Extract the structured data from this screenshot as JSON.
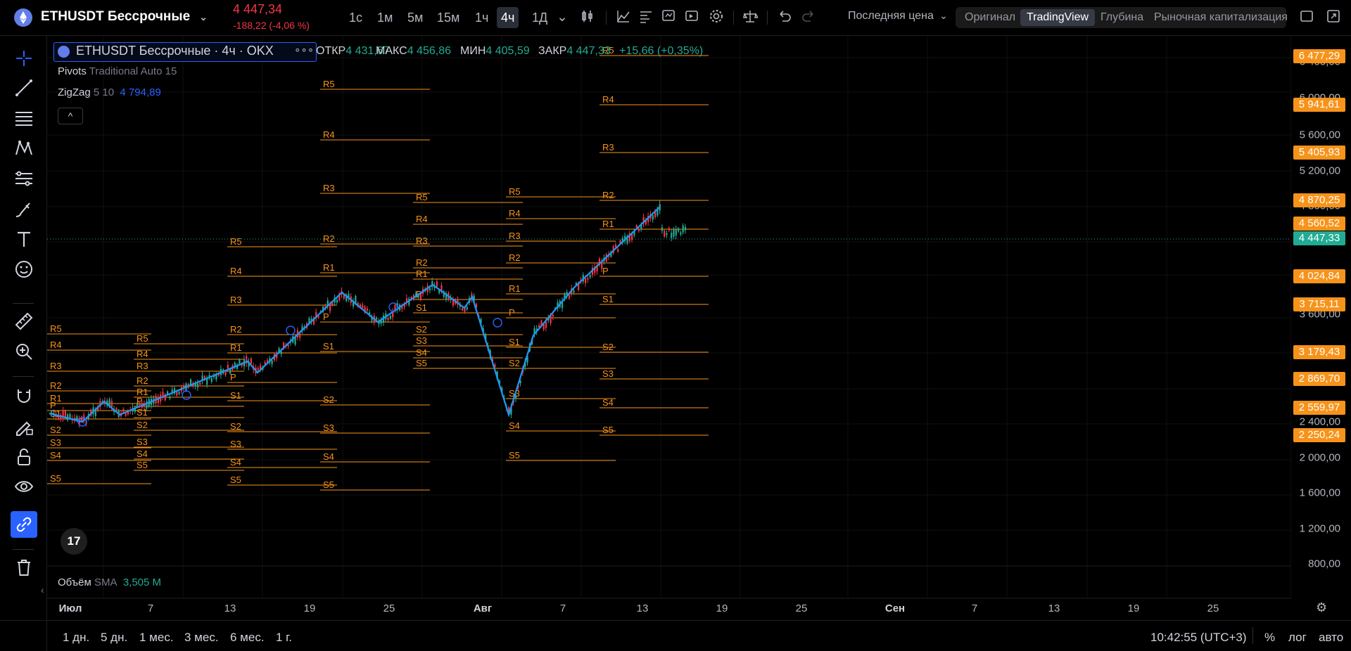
{
  "header": {
    "symbol": "ETHUSDT Бессрочные",
    "price": "4 447,34",
    "change": "-188,22 (-4,06 %)",
    "timeframes": [
      "1с",
      "1м",
      "5м",
      "15м",
      "1ч",
      "4ч",
      "1Д"
    ],
    "active_timeframe": "4ч",
    "price_type": "Последняя цена",
    "views": [
      "Оригинал",
      "TradingView",
      "Глубина",
      "Рыночная капитализация"
    ],
    "active_view": "TradingView"
  },
  "legend": {
    "title": "ETHUSDT Бессрочные · 4ч · OKX",
    "more": "∘∘∘",
    "ohlc": [
      {
        "key": "ОТКР",
        "value": "4 431,67"
      },
      {
        "key": "МАКС",
        "value": "4 456,86"
      },
      {
        "key": "МИН",
        "value": "4 405,59"
      },
      {
        "key": "ЗАКР",
        "value": "4 447,33"
      }
    ],
    "change": "+15,66 (+0,35%)",
    "indicators": [
      {
        "name": "Pivots",
        "params": "Traditional Auto 15",
        "value": ""
      },
      {
        "name": "ZigZag",
        "params": "5 10",
        "value": "4 794,89"
      }
    ],
    "collapse": "^"
  },
  "price_axis": {
    "ticks": [
      "6 400,00",
      "6 000,00",
      "5 600,00",
      "5 200,00",
      "4 800,00",
      "3 600,00",
      "2 400,00",
      "2 000,00",
      "1 600,00",
      "1 200,00",
      "800,00"
    ],
    "labels": [
      {
        "text": "6 477,29",
        "color": "#f7931a"
      },
      {
        "text": "5 941,61",
        "color": "#f7931a"
      },
      {
        "text": "5 405,93",
        "color": "#f7931a"
      },
      {
        "text": "4 870,25",
        "color": "#f7931a"
      },
      {
        "text": "4 560,52",
        "color": "#f7931a"
      },
      {
        "text": "4 447,33",
        "color": "#22ab94"
      },
      {
        "text": "4 024,84",
        "color": "#f7931a"
      },
      {
        "text": "3 715,11",
        "color": "#f7931a"
      },
      {
        "text": "3 179,43",
        "color": "#f7931a"
      },
      {
        "text": "2 869,70",
        "color": "#f7931a"
      },
      {
        "text": "2 559,97",
        "color": "#f7931a"
      },
      {
        "text": "2 250,24",
        "color": "#f7931a"
      }
    ]
  },
  "volume": {
    "name": "Объём",
    "ma": "SMA",
    "value": "3,505 M"
  },
  "time_axis": {
    "ticks": [
      "Июл",
      "7",
      "13",
      "19",
      "25",
      "Авг",
      "7",
      "13",
      "19",
      "25",
      "Сен",
      "7",
      "13",
      "19",
      "25"
    ],
    "bold": [
      "Июл",
      "Авг",
      "Сен"
    ]
  },
  "bottom": {
    "ranges": [
      "1 дн.",
      "5 дн.",
      "1 мес.",
      "3 мес.",
      "6 мес.",
      "1 г."
    ],
    "clock": "10:42:55 (UTC+3)",
    "percent": "%",
    "log": "лог",
    "auto": "авто"
  },
  "pivot_blocks": [
    {
      "labels": [
        "R5",
        "R4",
        "R3",
        "R2",
        "R1",
        "P",
        "S1",
        "S2",
        "S3",
        "S4",
        "S5"
      ]
    },
    {
      "labels": [
        "R5",
        "R4",
        "R3",
        "R2",
        "R1",
        "P",
        "S1",
        "S2",
        "S3",
        "S4",
        "S5"
      ]
    },
    {
      "labels": [
        "R5",
        "R4",
        "R3",
        "R2",
        "R1",
        "P",
        "S1",
        "S2",
        "S3",
        "S4",
        "S5"
      ]
    },
    {
      "labels": [
        "R5",
        "R4",
        "R3",
        "R2",
        "R1",
        "P",
        "S1",
        "S2",
        "S3",
        "S4",
        "S5"
      ]
    },
    {
      "labels": [
        "R5",
        "R4",
        "R3",
        "R2",
        "R1",
        "P",
        "S1",
        "S2",
        "S3",
        "S4",
        "S5"
      ]
    },
    {
      "labels": [
        "R5",
        "R4",
        "R3",
        "R2",
        "R1",
        "P",
        "S1",
        "S2",
        "S3",
        "S4",
        "S5"
      ]
    },
    {
      "labels": [
        "R5",
        "R4",
        "R3",
        "R2",
        "R1",
        "P",
        "S1",
        "S2",
        "S3",
        "S4",
        "S5"
      ]
    }
  ],
  "colors": {
    "pivot": "#f7931a",
    "zigzag": "#2196f3",
    "up": "#22ab94",
    "down": "#f23645",
    "accent": "#2962ff"
  }
}
